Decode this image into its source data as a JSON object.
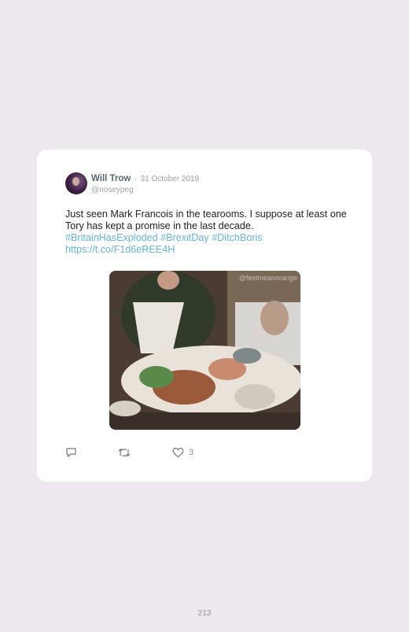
{
  "tweet": {
    "author_name": "Will Trow",
    "separator": "·",
    "date": "31 October 2019",
    "handle": "@noseypeg",
    "text": "Just seen Mark Francois in the tearooms. I suppose at least one Tory has kept a promise in the last decade.",
    "hashtags": "#BritainHasExploded #BrexitDay #DitchBoris",
    "link": "https://t.co/F1d6eREE4H",
    "media": {
      "watermark": "@feelmeanorange",
      "description": "gif of a man in an explosive buffet scene"
    },
    "actions": {
      "reply_icon": "speech-bubble-icon",
      "retweet_icon": "retweet-icon",
      "like_icon": "heart-icon",
      "like_count": "3"
    }
  },
  "page": {
    "number": "213"
  },
  "colors": {
    "background": "#ede7ee",
    "card": "#ffffff",
    "link": "#63b5d9",
    "muted": "#9aa3ab"
  }
}
